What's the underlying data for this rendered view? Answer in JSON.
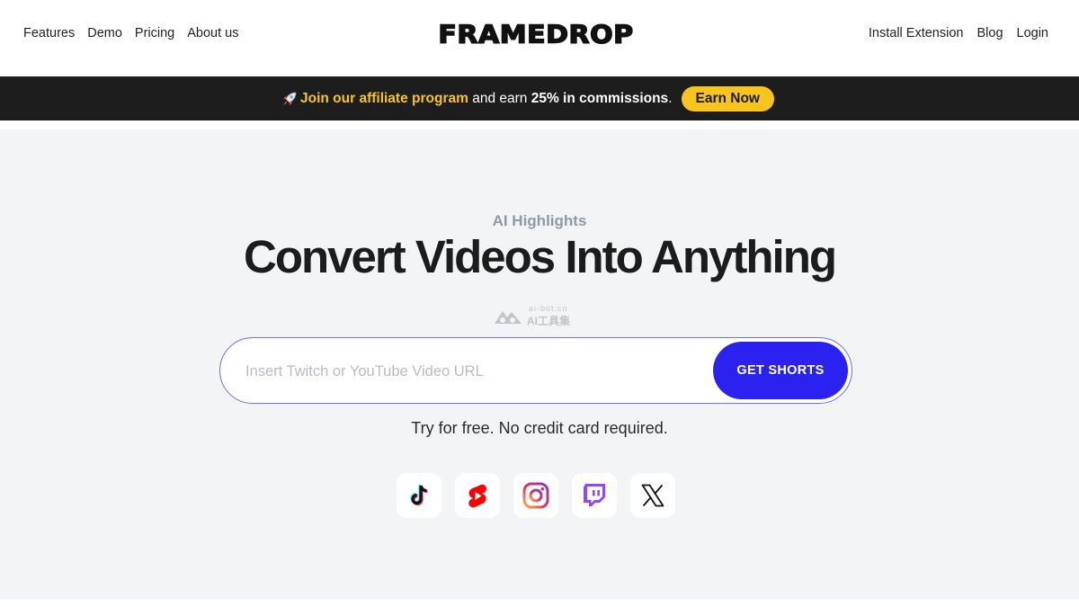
{
  "header": {
    "logo_text": "FRAMEDROP",
    "nav_left": [
      "Features",
      "Demo",
      "Pricing",
      "About us"
    ],
    "nav_right": [
      "Install Extension",
      "Blog",
      "Login"
    ]
  },
  "banner": {
    "icon": "rocket-icon",
    "highlight": "Join our affiliate program",
    "middle": " and earn ",
    "bold": "25% in commissions",
    "end": ".",
    "button_label": "Earn Now",
    "colors": {
      "background": "#1d1d1d",
      "accent": "#f7c51e"
    }
  },
  "hero": {
    "eyebrow": "AI Highlights",
    "title": "Convert Videos Into Anything",
    "watermark": {
      "small": "ai-bot.cn",
      "big": "AI工具集"
    },
    "input_placeholder": "Insert Twitch or YouTube Video URL",
    "input_value": "",
    "button_label": "GET SHORTS",
    "note": "Try for free. No credit card required.",
    "platforms": [
      "tiktok-icon",
      "youtube-shorts-icon",
      "instagram-icon",
      "twitch-icon",
      "x-icon"
    ],
    "colors": {
      "background": "#f3f4f6",
      "button": "#2b22f0",
      "eyebrow": "#8e9aa6"
    }
  }
}
